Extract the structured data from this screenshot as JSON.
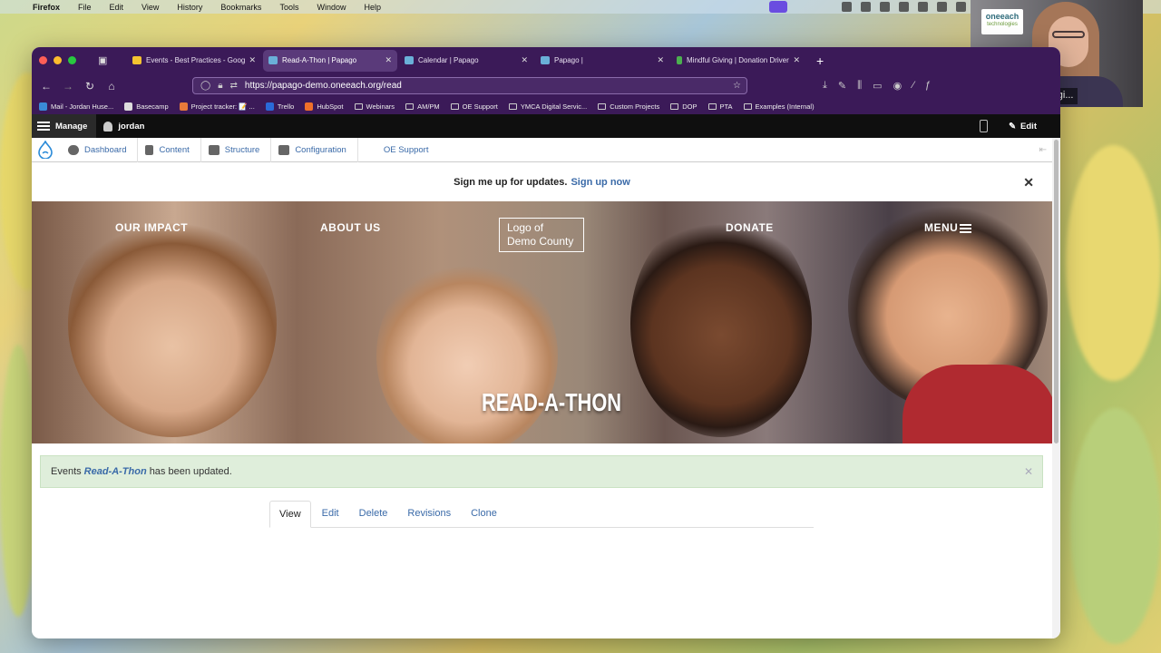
{
  "menubar": {
    "app": "Firefox",
    "items": [
      "File",
      "Edit",
      "View",
      "History",
      "Bookmarks",
      "Tools",
      "Window",
      "Help"
    ]
  },
  "webcam": {
    "logo_main": "oneeach",
    "logo_sub": "technologies",
    "name": "OneEach Technologi..."
  },
  "tabs": [
    {
      "label": "Events - Best Practices - Goog",
      "color": "#f4c430"
    },
    {
      "label": "Read-A-Thon | Papago",
      "color": "#6ab0d8"
    },
    {
      "label": "Calendar | Papago",
      "color": "#6ab0d8"
    },
    {
      "label": "Papago |",
      "color": "#6ab0d8"
    },
    {
      "label": "Mindful Giving | Donation Driver",
      "color": "#4caf50"
    }
  ],
  "url": "https://papago-demo.oneeach.org/read",
  "bookmarks": [
    {
      "label": "Mail - Jordan Huse...",
      "type": "fav",
      "color": "#3a8ad8"
    },
    {
      "label": "Basecamp",
      "type": "fav",
      "color": "#ddd"
    },
    {
      "label": "Project tracker: 📝 ...",
      "type": "fav",
      "color": "#e87a3a"
    },
    {
      "label": "Trello",
      "type": "fav",
      "color": "#2a6ad8"
    },
    {
      "label": "HubSpot",
      "type": "fav",
      "color": "#f0702a"
    },
    {
      "label": "Webinars",
      "type": "folder"
    },
    {
      "label": "AM/PM",
      "type": "folder"
    },
    {
      "label": "OE Support",
      "type": "folder"
    },
    {
      "label": "YMCA Digital Servic...",
      "type": "folder"
    },
    {
      "label": "Custom Projects",
      "type": "folder"
    },
    {
      "label": "DOP",
      "type": "folder"
    },
    {
      "label": "PTA",
      "type": "folder"
    },
    {
      "label": "Examples (Internal)",
      "type": "folder"
    }
  ],
  "admin": {
    "manage": "Manage",
    "user": "jordan",
    "edit": "Edit"
  },
  "tray": {
    "items": [
      "Dashboard",
      "Content",
      "Structure",
      "Configuration"
    ],
    "oe_support": "OE Support"
  },
  "notice": {
    "text": "Sign me up for updates.",
    "link": "Sign up now"
  },
  "hero": {
    "nav": [
      "OUR IMPACT",
      "ABOUT US",
      "DONATE"
    ],
    "menu": "MENU",
    "logo_line1": "Logo of",
    "logo_line2": "Demo County",
    "title": "READ-A-THON"
  },
  "status": {
    "prefix": "Events",
    "item": "Read-A-Thon",
    "suffix": "has been updated."
  },
  "local_tabs": [
    "View",
    "Edit",
    "Delete",
    "Revisions",
    "Clone"
  ]
}
